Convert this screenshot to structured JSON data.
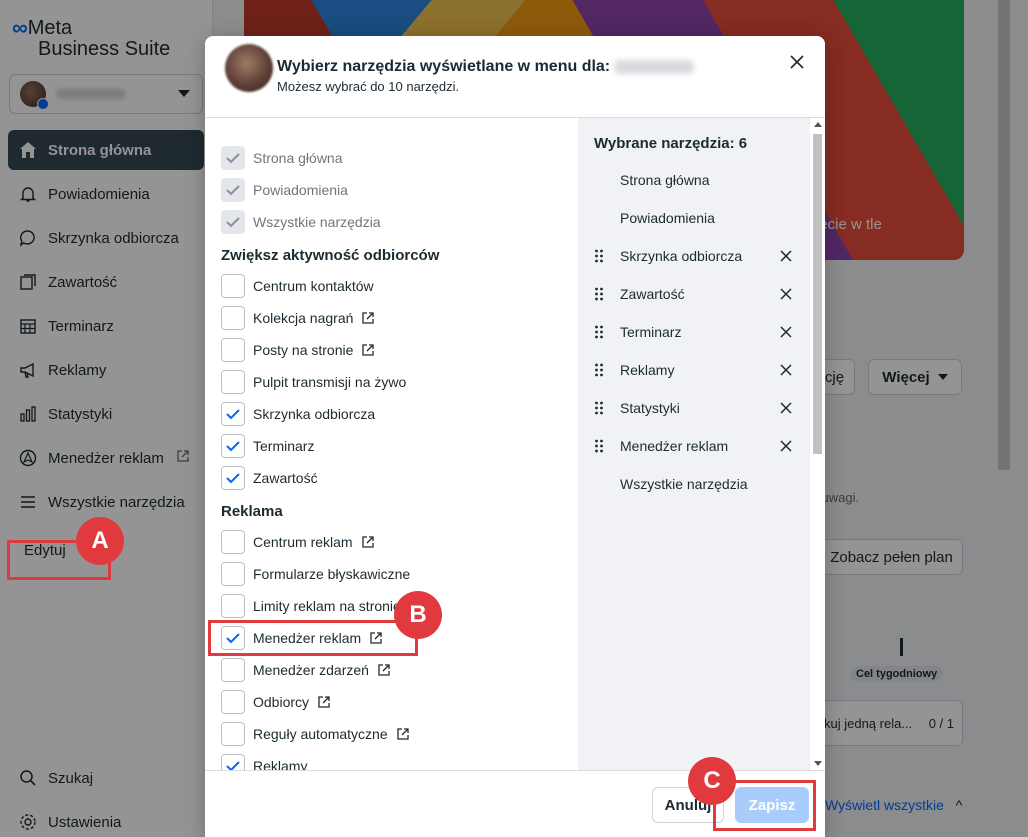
{
  "brand": {
    "meta": "Meta",
    "suite": "Business Suite"
  },
  "sidebar": {
    "items": [
      {
        "label": "Strona główna",
        "icon": "home-icon"
      },
      {
        "label": "Powiadomienia",
        "icon": "bell-icon"
      },
      {
        "label": "Skrzynka odbiorcza",
        "icon": "chat-icon"
      },
      {
        "label": "Zawartość",
        "icon": "content-icon"
      },
      {
        "label": "Terminarz",
        "icon": "calendar-icon"
      },
      {
        "label": "Reklamy",
        "icon": "megaphone-icon"
      },
      {
        "label": "Statystyki",
        "icon": "bar-chart-icon"
      },
      {
        "label": "Menedżer reklam",
        "icon": "ads-manager-icon"
      },
      {
        "label": "Wszystkie narzędzia",
        "icon": "menu-icon"
      }
    ],
    "edit_label": "Edytuj",
    "search_label": "Szukaj",
    "settings_label": "Ustawienia"
  },
  "background": {
    "cover_text": "jęcie w tle",
    "more_button": "Więcej",
    "partial_button": "cję",
    "attention_text": "j uwagi.",
    "plan_button": "Zobacz pełen plan",
    "weekly_goal": "Cel tygodniowy",
    "task_text": "kuj jedną rela...",
    "task_count": "0 / 1",
    "see_all": "Wyświetl wszystkie"
  },
  "modal": {
    "title": "Wybierz narzędzia wyświetlane w menu dla:",
    "subtitle": "Możesz wybrać do 10 narzędzi.",
    "fixed_items": [
      "Strona główna",
      "Powiadomienia",
      "Wszystkie narzędzia"
    ],
    "section_engage": "Zwiększ aktywność odbiorców",
    "engage_items": [
      {
        "label": "Centrum kontaktów",
        "checked": false,
        "external": false
      },
      {
        "label": "Kolekcja nagrań",
        "checked": false,
        "external": true
      },
      {
        "label": "Posty na stronie",
        "checked": false,
        "external": true
      },
      {
        "label": "Pulpit transmisji na żywo",
        "checked": false,
        "external": false
      },
      {
        "label": "Skrzynka odbiorcza",
        "checked": true,
        "external": false
      },
      {
        "label": "Terminarz",
        "checked": true,
        "external": false
      },
      {
        "label": "Zawartość",
        "checked": true,
        "external": false
      }
    ],
    "section_ads": "Reklama",
    "ads_items": [
      {
        "label": "Centrum reklam",
        "checked": false,
        "external": true
      },
      {
        "label": "Formularze błyskawiczne",
        "checked": false,
        "external": false
      },
      {
        "label": "Limity reklam na stronie",
        "checked": false,
        "external": false
      },
      {
        "label": "Menedżer reklam",
        "checked": true,
        "external": true
      },
      {
        "label": "Menedżer zdarzeń",
        "checked": false,
        "external": true
      },
      {
        "label": "Odbiorcy",
        "checked": false,
        "external": true
      },
      {
        "label": "Reguły automatyczne",
        "checked": false,
        "external": true
      },
      {
        "label": "Reklamy",
        "checked": true,
        "external": false
      }
    ],
    "selected_title": "Wybrane narzędzia: 6",
    "selected_items": [
      {
        "label": "Strona główna",
        "removable": false
      },
      {
        "label": "Powiadomienia",
        "removable": false
      },
      {
        "label": "Skrzynka odbiorcza",
        "removable": true
      },
      {
        "label": "Zawartość",
        "removable": true
      },
      {
        "label": "Terminarz",
        "removable": true
      },
      {
        "label": "Reklamy",
        "removable": true
      },
      {
        "label": "Statystyki",
        "removable": true
      },
      {
        "label": "Menedżer reklam",
        "removable": true
      },
      {
        "label": "Wszystkie narzędzia",
        "removable": false
      }
    ],
    "cancel_label": "Anuluj",
    "save_label": "Zapisz"
  },
  "annotations": {
    "a": "A",
    "b": "B",
    "c": "C",
    "color": "#e03a3e"
  },
  "colors": {
    "active_nav": "#344854",
    "accent": "#0866ff",
    "check": "#0866ff",
    "save_disabled": "#a9cdfa"
  }
}
